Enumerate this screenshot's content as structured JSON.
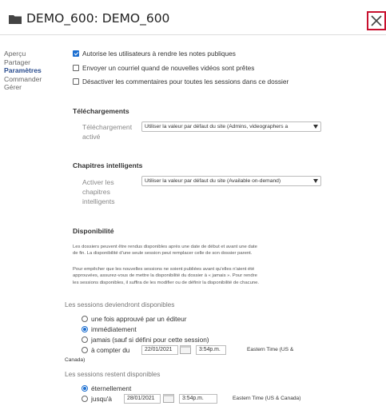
{
  "header": {
    "title": "DEMO_600: DEMO_600",
    "close_label": "close"
  },
  "sidebar": {
    "items": [
      {
        "label": "Aperçu"
      },
      {
        "label": "Partager"
      },
      {
        "label": "Paramètres",
        "active": true
      },
      {
        "label": "Commander"
      },
      {
        "label": "Gérer"
      }
    ]
  },
  "settings": {
    "checkboxes": [
      {
        "label": "Autorise les utilisateurs à rendre les notes publiques",
        "checked": true
      },
      {
        "label": "Envoyer un courriel quand de nouvelles vidéos sont prêtes",
        "checked": false
      },
      {
        "label": "Désactiver les commentaires pour toutes les sessions dans ce dossier",
        "checked": false
      }
    ]
  },
  "downloads": {
    "section_title": "Téléchargements",
    "field_label_1": "Téléchargement",
    "field_label_2": "activé",
    "selected": "Utiliser la valeur par défaut du site (Admins, videographers a"
  },
  "smart_chapters": {
    "section_title": "Chapitres intelligents",
    "field_label_1": "Activer les",
    "field_label_2": "chapitres",
    "field_label_3": "intelligents",
    "selected": "Utiliser la valeur par défaut du site (Available on-demand)"
  },
  "availability": {
    "section_title": "Disponibilité",
    "para1_line1": "Les dossiers peuvent être rendus disponibles après une date de début et avant une date",
    "para1_line2": "de fin. La disponibilité d'une seule session peut remplacer celle de son dossier parent.",
    "para2_line1": "Pour empêcher que les nouvelles sessions ne soient publiées avant qu'elles n'aient été",
    "para2_line2": "approuvées, assurez-vous de mettre la disponibilité du dossier à « jamais ». Pour rendre",
    "para2_line3": "les sessions disponibles, il suffira de les modifier ou de définir la disponibilité de chacune.",
    "start_heading": "Les sessions deviendront disponibles",
    "start_options": [
      {
        "label": "une fois approuvé par un éditeur",
        "checked": false
      },
      {
        "label": "immédiatement",
        "checked": true
      },
      {
        "label": "jamais (sauf si défini pour cette session)",
        "checked": false
      },
      {
        "label": "à compter du",
        "checked": false
      }
    ],
    "start_date": "22/01/2021",
    "start_time": "3:54p.m.",
    "start_tz_part1": "Eastern Time (US &",
    "start_tz_part2": "Canada)",
    "end_heading": "Les sessions restent disponibles",
    "end_options": [
      {
        "label": "éternellement",
        "checked": true
      },
      {
        "label": "jusqu'à",
        "checked": false
      }
    ],
    "end_date": "28/01/2021",
    "end_time": "3:54p.m.",
    "end_tz": "Eastern Time (US & Canada)"
  },
  "colors": {
    "accent": "#1d6fd1",
    "nav_active": "#2a4d8f",
    "close_border": "#c8102e"
  }
}
